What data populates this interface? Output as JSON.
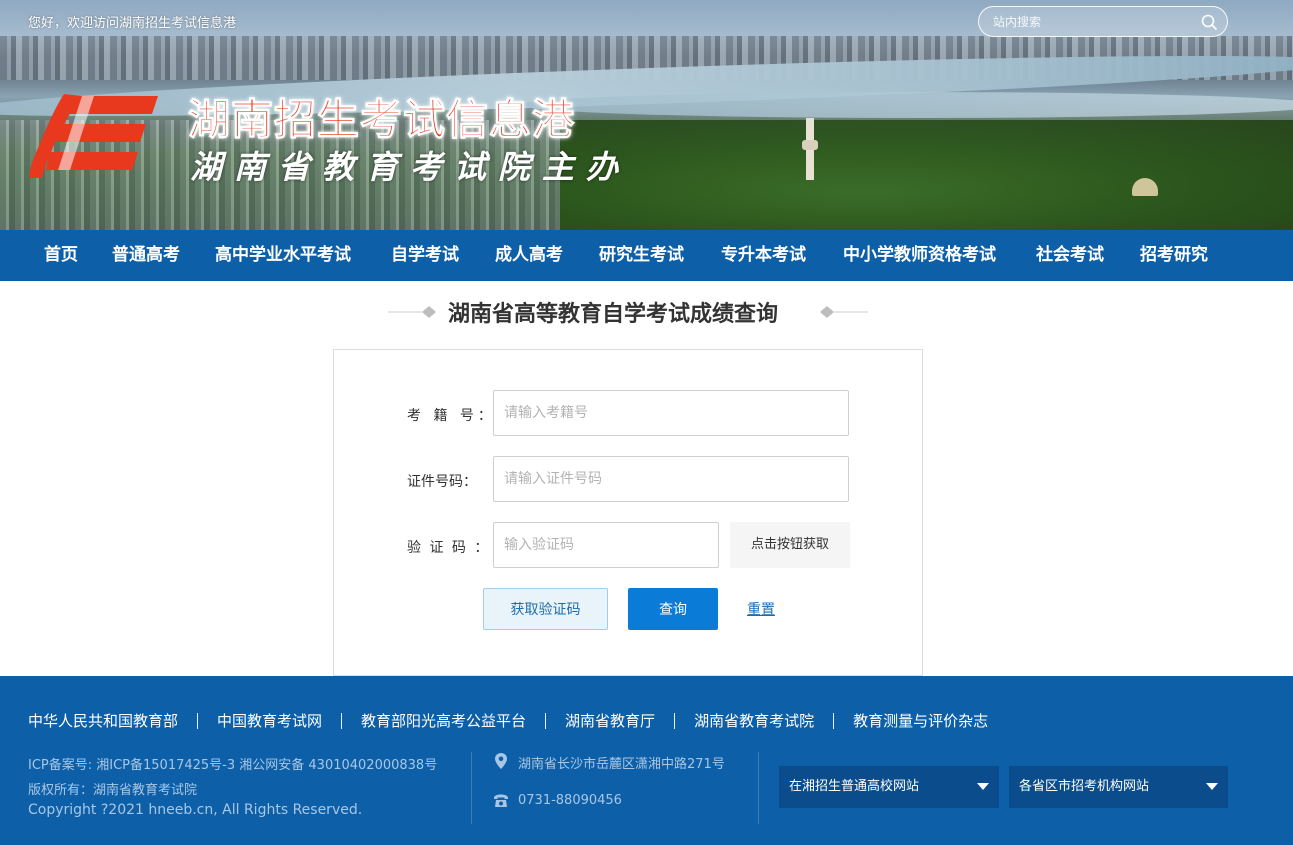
{
  "header": {
    "welcome": "您好，欢迎访问湖南招生考试信息港",
    "search_placeholder": "站内搜索",
    "site_title": "湖南招生考试信息港",
    "site_subtitle": "湖南省教育考试院主办"
  },
  "nav": {
    "items": [
      "首页",
      "普通高考",
      "高中学业水平考试",
      "自学考试",
      "成人高考",
      "研究生考试",
      "专升本考试",
      "中小学教师资格考试",
      "社会考试",
      "招考研究"
    ]
  },
  "main": {
    "page_title": "湖南省高等教育自学考试成绩查询",
    "form": {
      "exam_id_label": "考  籍  号：",
      "exam_id_placeholder": "请输入考籍号",
      "id_number_label": "证件号码：",
      "id_number_placeholder": "请输入证件号码",
      "captcha_label": "验  证  码  ：",
      "captcha_placeholder": "输入验证码",
      "captcha_button": "点击按钮获取",
      "get_code_button": "获取验证码",
      "query_button": "查询",
      "reset_link": "重置"
    }
  },
  "footer": {
    "links": [
      "中华人民共和国教育部",
      "中国教育考试网",
      "教育部阳光高考公益平台",
      "湖南省教育厅",
      "湖南省教育考试院",
      "教育测量与评价杂志"
    ],
    "icp": "ICP备案号: 湘ICP备15017425号-3 湘公网安备 43010402000838号",
    "owner": "版权所有：湖南省教育考试院",
    "copyright": "Copyright ?2021 hneeb.cn, All Rights Reserved.",
    "address": "湖南省长沙市岳麓区潇湘中路271号",
    "phone": "0731-88090456",
    "select_universities": "在湘招生普通高校网站",
    "select_provinces": "各省区市招考机构网站",
    "icons": {
      "address": "location-pin-icon",
      "phone": "phone-icon"
    }
  },
  "colors": {
    "nav_bg": "#0d5fa8",
    "footer_bg": "#0d5fa8",
    "title_red": "#e8381e",
    "primary_button": "#0a7bd6",
    "link": "#1a6cb2"
  }
}
